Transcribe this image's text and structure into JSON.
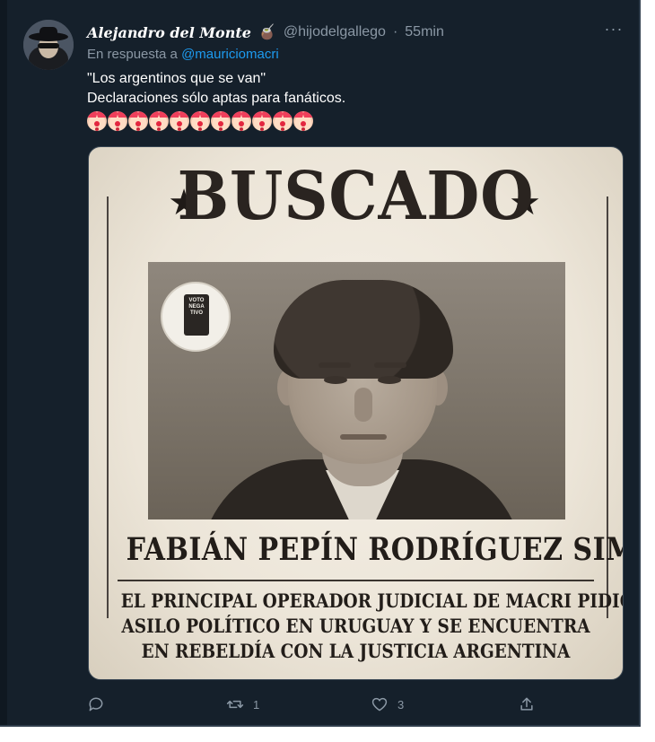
{
  "tweet": {
    "author_name": "Alejandro del Monte",
    "author_emoji": "🧉",
    "handle": "@hijodelgallego",
    "separator": "·",
    "time": "55min",
    "reply_prefix": "En respuesta a",
    "reply_handle": "@mauriciomacri",
    "text_line1": "\"Los argentinos que se van\"",
    "text_line2": "Declaraciones sólo aptas para fanáticos.",
    "emoji_icons": [
      "clown-face-icon",
      "clown-face-icon",
      "clown-face-icon",
      "clown-face-icon",
      "clown-face-icon",
      "clown-face-icon",
      "clown-face-icon",
      "clown-face-icon",
      "clown-face-icon",
      "clown-face-icon",
      "clown-face-icon"
    ],
    "more_label": "···"
  },
  "poster": {
    "headline": "BUSCADO",
    "star": "★",
    "badge_text": "VOTO NEGA TIVO",
    "name": "FABIÁN PEPÍN RODRÍGUEZ SIMÓN",
    "desc_line1": "EL PRINCIPAL OPERADOR JUDICIAL DE MACRI PIDIÓ",
    "desc_line2": "ASILO POLÍTICO EN URUGUAY Y SE ENCUENTRA",
    "desc_line3": "EN REBELDÍA CON LA JUSTICIA ARGENTINA"
  },
  "actions": {
    "reply_count": "",
    "retweet_count": "1",
    "like_count": "3"
  },
  "colors": {
    "background": "#15202b",
    "text_secondary": "#8b98a5",
    "link": "#1d9bf0"
  }
}
